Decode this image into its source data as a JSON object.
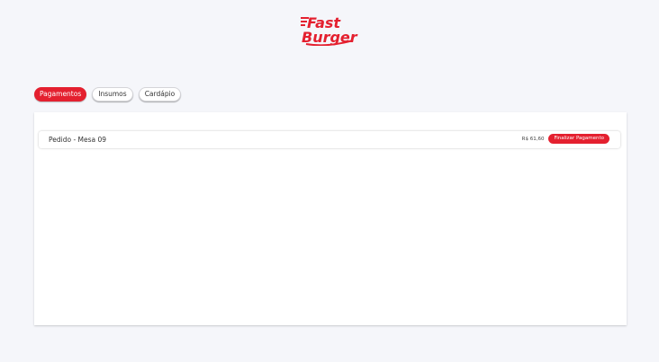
{
  "brand": {
    "logo_line1": "Fast",
    "logo_line2": "Burger",
    "color": "#e4202f"
  },
  "tabs": [
    {
      "label": "Pagamentos",
      "active": true
    },
    {
      "label": "Insumos",
      "active": false
    },
    {
      "label": "Cardápio",
      "active": false
    }
  ],
  "orders": [
    {
      "title": "Pedido - Mesa 09",
      "price": "R$ 61,60",
      "action_label": "Finalizar Pagamento"
    }
  ]
}
